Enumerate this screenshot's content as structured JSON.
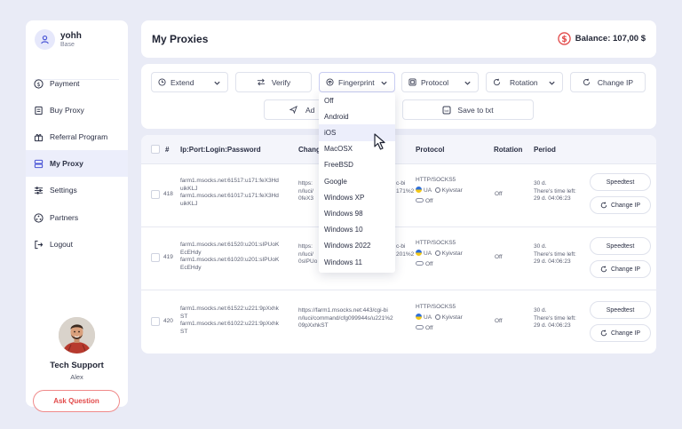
{
  "sidebar": {
    "user": {
      "name": "yohh",
      "plan": "Base"
    },
    "items": [
      {
        "label": "Payment",
        "icon": "dollar-circle-icon"
      },
      {
        "label": "Buy Proxy",
        "icon": "document-icon"
      },
      {
        "label": "Referral Program",
        "icon": "gift-icon"
      },
      {
        "label": "My Proxy",
        "icon": "server-icon",
        "active": true
      },
      {
        "label": "Settings",
        "icon": "sliders-icon"
      },
      {
        "label": "Partners",
        "icon": "partners-icon"
      },
      {
        "label": "Logout",
        "icon": "logout-icon"
      }
    ],
    "support": {
      "title": "Tech Support",
      "name": "Alex",
      "button": "Ask Question"
    }
  },
  "header": {
    "title": "My Proxies",
    "balance": "Balance: 107,00 $"
  },
  "toolbar": {
    "extend": "Extend",
    "verify": "Verify",
    "fingerprint": "Fingerprint",
    "protocol": "Protocol",
    "rotation": "Rotation",
    "change_ip": "Change IP",
    "add": "Ad",
    "save": "Save to txt"
  },
  "dropdown": {
    "options": [
      "Off",
      "Android",
      "iOS",
      "MacOSX",
      "FreeBSD",
      "Google",
      "Windows XP",
      "Windows 98",
      "Windows 10",
      "Windows 2022",
      "Windows 11"
    ],
    "highlighted": "iOS"
  },
  "table": {
    "headers": {
      "num": "#",
      "ip": "Ip:Port:Login:Password",
      "change": "Chang",
      "protocol": "Protocol",
      "rotation": "Rotation",
      "period": "Period"
    },
    "rows": [
      {
        "num": "418",
        "ip": [
          "farm1.msocks.net:61517:u171:feX3Hd",
          "uikKLJ",
          "farm1.msocks.net:61017:u171:feX3Hd",
          "uikKLJ"
        ],
        "change": [
          "https:",
          "n/luci/",
          "0feX3"
        ],
        "change_tail": [
          "c-bi",
          "171%2"
        ],
        "protocol": "HTTP/SOCKS5",
        "country": "UA",
        "isp": "Kyivstar",
        "off": "Off",
        "rotation": "Off",
        "period": [
          "30 d.",
          "There's time left:",
          "29 d. 04:06:23"
        ],
        "speedtest": "Speedtest",
        "change_ip": "Change IP"
      },
      {
        "num": "419",
        "ip": [
          "farm1.msocks.net:61520:u201:sIPUoK",
          "EcEHdy",
          "farm1.msocks.net:61020:u201:sIPUoK",
          "EcEHdy"
        ],
        "change": [
          "https:",
          "n/luci/",
          "0sIPUo"
        ],
        "change_tail": [
          "c-bi",
          "201%2"
        ],
        "protocol": "HTTP/SOCKS5",
        "country": "UA",
        "isp": "Kyivstar",
        "off": "Off",
        "rotation": "Off",
        "period": [
          "30 d.",
          "There's time left:",
          "29 d. 04:06:23"
        ],
        "speedtest": "Speedtest",
        "change_ip": "Change IP"
      },
      {
        "num": "420",
        "ip": [
          "farm1.msocks.net:61522:u221:9pXxhk",
          "ST",
          "farm1.msocks.net:61022:u221:9pXxhk",
          "ST"
        ],
        "change": [
          "https://farm1.msocks.net:443/cgi-bi",
          "n/luci/command/cfg099944s/u221%2",
          "09pXxhkST"
        ],
        "change_tail": [],
        "protocol": "HTTP/SOCKS5",
        "country": "UA",
        "isp": "Kyivstar",
        "off": "Off",
        "rotation": "Off",
        "period": [
          "30 d.",
          "There's time left:",
          "29 d. 04:06:23"
        ],
        "speedtest": "Speedtest",
        "change_ip": "Change IP"
      }
    ]
  },
  "colors": {
    "accent": "#4a55d6",
    "danger": "#e24a4a",
    "active_bg": "#eceefb"
  }
}
